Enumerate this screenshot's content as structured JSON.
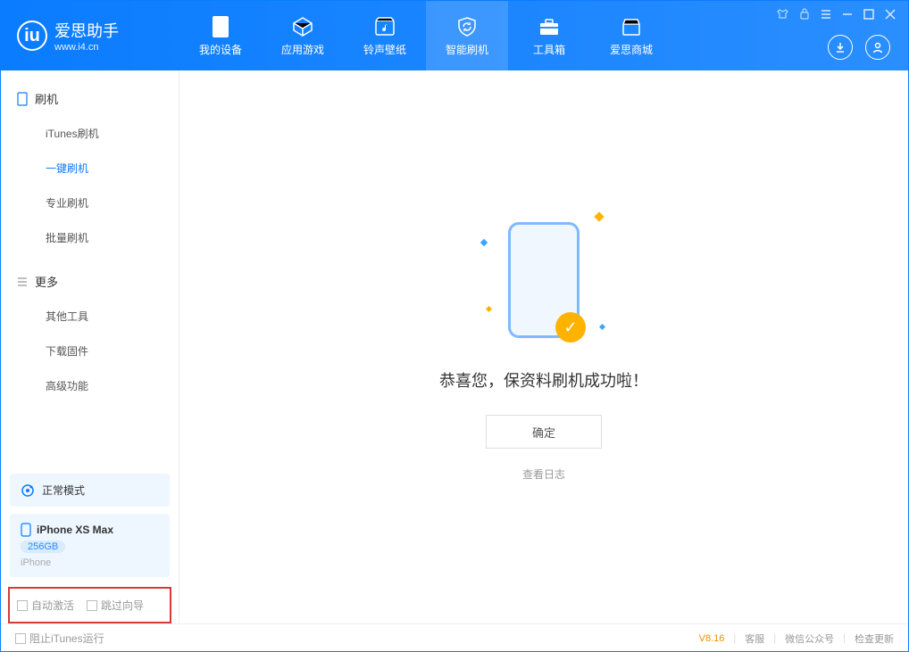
{
  "app": {
    "title": "爱思助手",
    "subtitle": "www.i4.cn"
  },
  "nav": {
    "items": [
      {
        "label": "我的设备"
      },
      {
        "label": "应用游戏"
      },
      {
        "label": "铃声壁纸"
      },
      {
        "label": "智能刷机"
      },
      {
        "label": "工具箱"
      },
      {
        "label": "爱思商城"
      }
    ]
  },
  "sidebar": {
    "group1": {
      "title": "刷机",
      "items": [
        "iTunes刷机",
        "一键刷机",
        "专业刷机",
        "批量刷机"
      ],
      "activeIndex": 1
    },
    "group2": {
      "title": "更多",
      "items": [
        "其他工具",
        "下载固件",
        "高级功能"
      ]
    },
    "status": "正常模式",
    "device": {
      "name": "iPhone XS Max",
      "storage": "256GB",
      "type": "iPhone"
    },
    "checks": {
      "autoActivate": "自动激活",
      "skipGuide": "跳过向导"
    }
  },
  "main": {
    "message": "恭喜您，保资料刷机成功啦！",
    "okButton": "确定",
    "viewLog": "查看日志"
  },
  "footer": {
    "blockItunes": "阻止iTunes运行",
    "version": "V8.16",
    "links": [
      "客服",
      "微信公众号",
      "检查更新"
    ]
  }
}
